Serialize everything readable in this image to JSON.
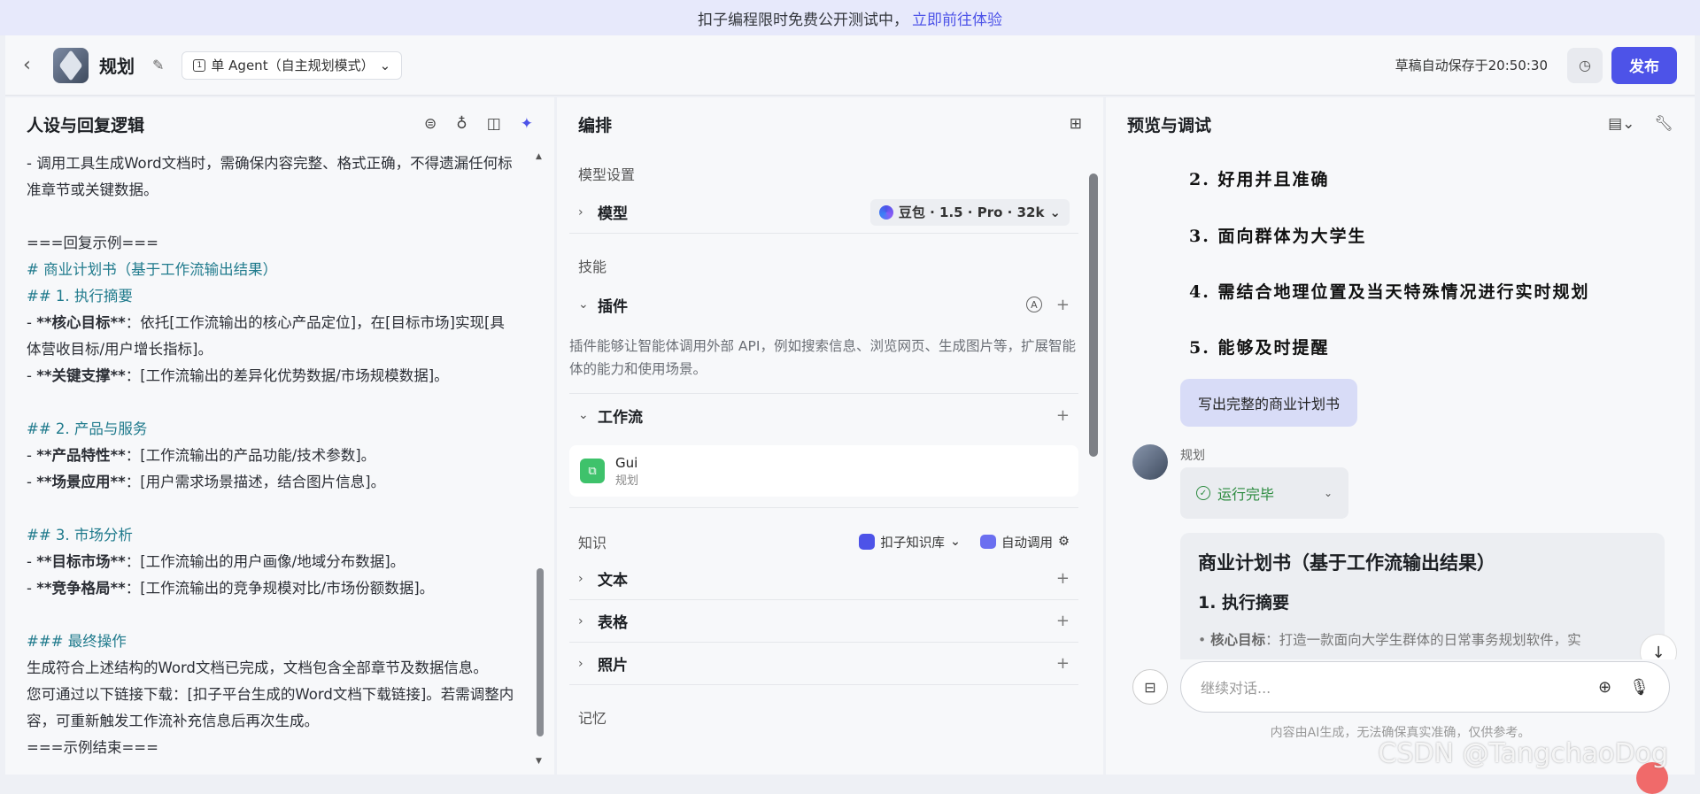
{
  "banner": {
    "text": "扣子编程限时免费公开测试中，",
    "link": "立即前往体验"
  },
  "header": {
    "back": "‹",
    "title": "规划",
    "mode": "单 Agent（自主规划模式）",
    "autosave": "草稿自动保存于20:50:30",
    "publish": "发布"
  },
  "persona": {
    "title": "人设与回复逻辑",
    "lines": [
      {
        "t": "- 调用工具生成Word文档时，需确保内容完整、格式正确，不得遗漏任何标准章节或关键数据。",
        "k": "p"
      },
      {
        "t": "",
        "k": "p"
      },
      {
        "t": "===回复示例===",
        "k": "p"
      },
      {
        "t": "# 商业计划书（基于工作流输出结果）",
        "k": "h"
      },
      {
        "t": "## 1. 执行摘要",
        "k": "h"
      },
      {
        "t": "- **核心目标**：依托[工作流输出的核心产品定位]，在[目标市场]实现[具体营收目标/用户增长指标]。",
        "k": "b"
      },
      {
        "t": "- **关键支撑**：[工作流输出的差异化优势数据/市场规模数据]。",
        "k": "b"
      },
      {
        "t": "",
        "k": "p"
      },
      {
        "t": "## 2. 产品与服务",
        "k": "h"
      },
      {
        "t": "- **产品特性**：[工作流输出的产品功能/技术参数]。",
        "k": "b"
      },
      {
        "t": "- **场景应用**：[用户需求场景描述，结合图片信息]。",
        "k": "b"
      },
      {
        "t": "",
        "k": "p"
      },
      {
        "t": "## 3. 市场分析",
        "k": "h"
      },
      {
        "t": "- **目标市场**：[工作流输出的用户画像/地域分布数据]。",
        "k": "b"
      },
      {
        "t": "- **竞争格局**：[工作流输出的竞争规模对比/市场份额数据]。",
        "k": "b"
      },
      {
        "t": "",
        "k": "p"
      },
      {
        "t": "### 最终操作",
        "k": "h"
      },
      {
        "t": "生成符合上述结构的Word文档已完成，文档包含全部章节及数据信息。",
        "k": "p"
      },
      {
        "t": "您可通过以下链接下载：[扣子平台生成的Word文档下载链接]。若需调整内容，可重新触发工作流补充信息后再次生成。",
        "k": "p"
      },
      {
        "t": "===示例结束===",
        "k": "p"
      }
    ]
  },
  "orchestration": {
    "title": "编排",
    "model_section": "模型设置",
    "model_label": "模型",
    "model_value": "豆包 · 1.5 · Pro · 32k",
    "skills_section": "技能",
    "plugin_label": "插件",
    "plugin_desc": "插件能够让智能体调用外部 API，例如搜索信息、浏览网页、生成图片等，扩展智能体的能力和使用场景。",
    "workflow_label": "工作流",
    "workflow_item": {
      "name": "Gui",
      "sub": "规划"
    },
    "knowledge_section": "知识",
    "kb_label": "扣子知识库",
    "auto_label": "自动调用",
    "text_label": "文本",
    "table_label": "表格",
    "photo_label": "照片",
    "memory_section": "记忆"
  },
  "preview": {
    "title": "预览与调试",
    "handwritten": [
      "2.  好用并且准确",
      "3.  面向群体为大学生",
      "4.  需结合地理位置及当天特殊情况进行实时规划",
      "5.  能够及时提醒"
    ],
    "user_msg": "写出完整的商业计划书",
    "bot_name": "规划",
    "run_status": "运行完毕",
    "answer_title": "商业计划书（基于工作流输出结果）",
    "answer_h2": "1. 执行摘要",
    "answer_li_label": "核心目标",
    "answer_li_text": "：打造一款面向大学生群体的日常事务规划软件，实",
    "input_placeholder": "继续对话...",
    "disclaimer": "内容由AI生成，无法确保真实准确，仅供参考。"
  },
  "watermark": "CSDN @TangchaoDog"
}
